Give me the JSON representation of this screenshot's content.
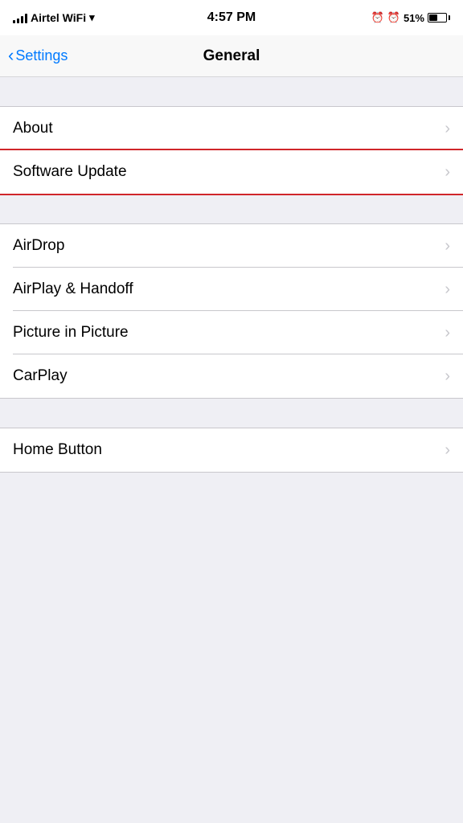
{
  "statusBar": {
    "carrier": "Airtel WiFi",
    "time": "4:57 PM",
    "alarm_icon": "⏰",
    "clock_icon": "🕐",
    "battery_percent": "51%"
  },
  "navBar": {
    "back_label": "Settings",
    "title": "General"
  },
  "groups": [
    {
      "id": "group1",
      "rows": [
        {
          "id": "about",
          "label": "About",
          "highlighted": false
        },
        {
          "id": "software-update",
          "label": "Software Update",
          "highlighted": true
        }
      ]
    },
    {
      "id": "group2",
      "rows": [
        {
          "id": "airdrop",
          "label": "AirDrop",
          "highlighted": false
        },
        {
          "id": "airplay-handoff",
          "label": "AirPlay & Handoff",
          "highlighted": false
        },
        {
          "id": "picture-in-picture",
          "label": "Picture in Picture",
          "highlighted": false
        },
        {
          "id": "carplay",
          "label": "CarPlay",
          "highlighted": false
        }
      ]
    },
    {
      "id": "group3",
      "rows": [
        {
          "id": "home-button",
          "label": "Home Button",
          "highlighted": false
        }
      ]
    }
  ],
  "chevron": "›"
}
